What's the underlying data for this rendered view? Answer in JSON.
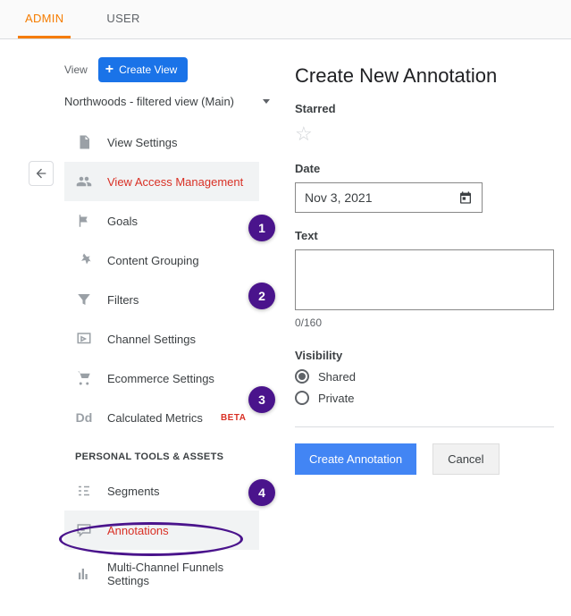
{
  "tabs": {
    "admin": "ADMIN",
    "user": "USER"
  },
  "view_label": "View",
  "create_view": "Create View",
  "view_dropdown": "Northwoods - filtered view (Main)",
  "menu": {
    "settings": "View Settings",
    "access": "View Access Management",
    "goals": "Goals",
    "content_grouping": "Content Grouping",
    "filters": "Filters",
    "channel": "Channel Settings",
    "ecommerce": "Ecommerce Settings",
    "calculated": "Calculated Metrics",
    "beta": "BETA",
    "section": "PERSONAL TOOLS & ASSETS",
    "segments": "Segments",
    "annotations": "Annotations",
    "mcf": "Multi-Channel Funnels Settings"
  },
  "form": {
    "title": "Create New Annotation",
    "starred_label": "Starred",
    "date_label": "Date",
    "date_value": "Nov 3, 2021",
    "text_label": "Text",
    "text_value": "",
    "counter": "0/160",
    "visibility_label": "Visibility",
    "shared": "Shared",
    "private": "Private",
    "submit": "Create Annotation",
    "cancel": "Cancel"
  },
  "badges": {
    "b1": "1",
    "b2": "2",
    "b3": "3",
    "b4": "4"
  }
}
